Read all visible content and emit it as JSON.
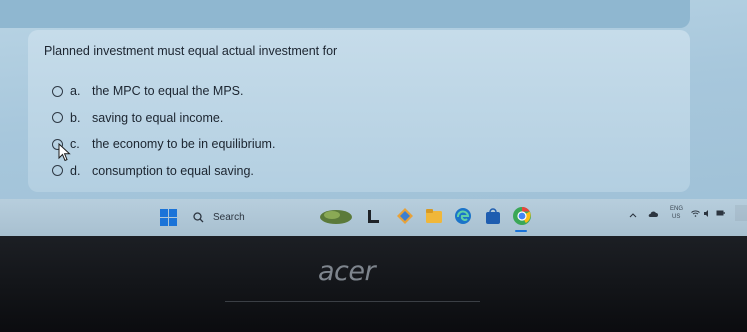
{
  "question": {
    "text": "Planned investment must equal actual investment for",
    "options": [
      {
        "letter": "a.",
        "text": "the MPC to equal the MPS."
      },
      {
        "letter": "b.",
        "text": "saving to equal income."
      },
      {
        "letter": "c.",
        "text": "the economy to be in equilibrium."
      },
      {
        "letter": "d.",
        "text": "consumption to equal saving."
      }
    ]
  },
  "taskbar": {
    "search_label": "Search",
    "lang": "ENG",
    "region": "US"
  },
  "bezel": {
    "brand": "acer"
  },
  "colors": {
    "accent": "#1a73d8",
    "screen_bg": "#a7c7dc",
    "bezel": "#0d0f12"
  }
}
